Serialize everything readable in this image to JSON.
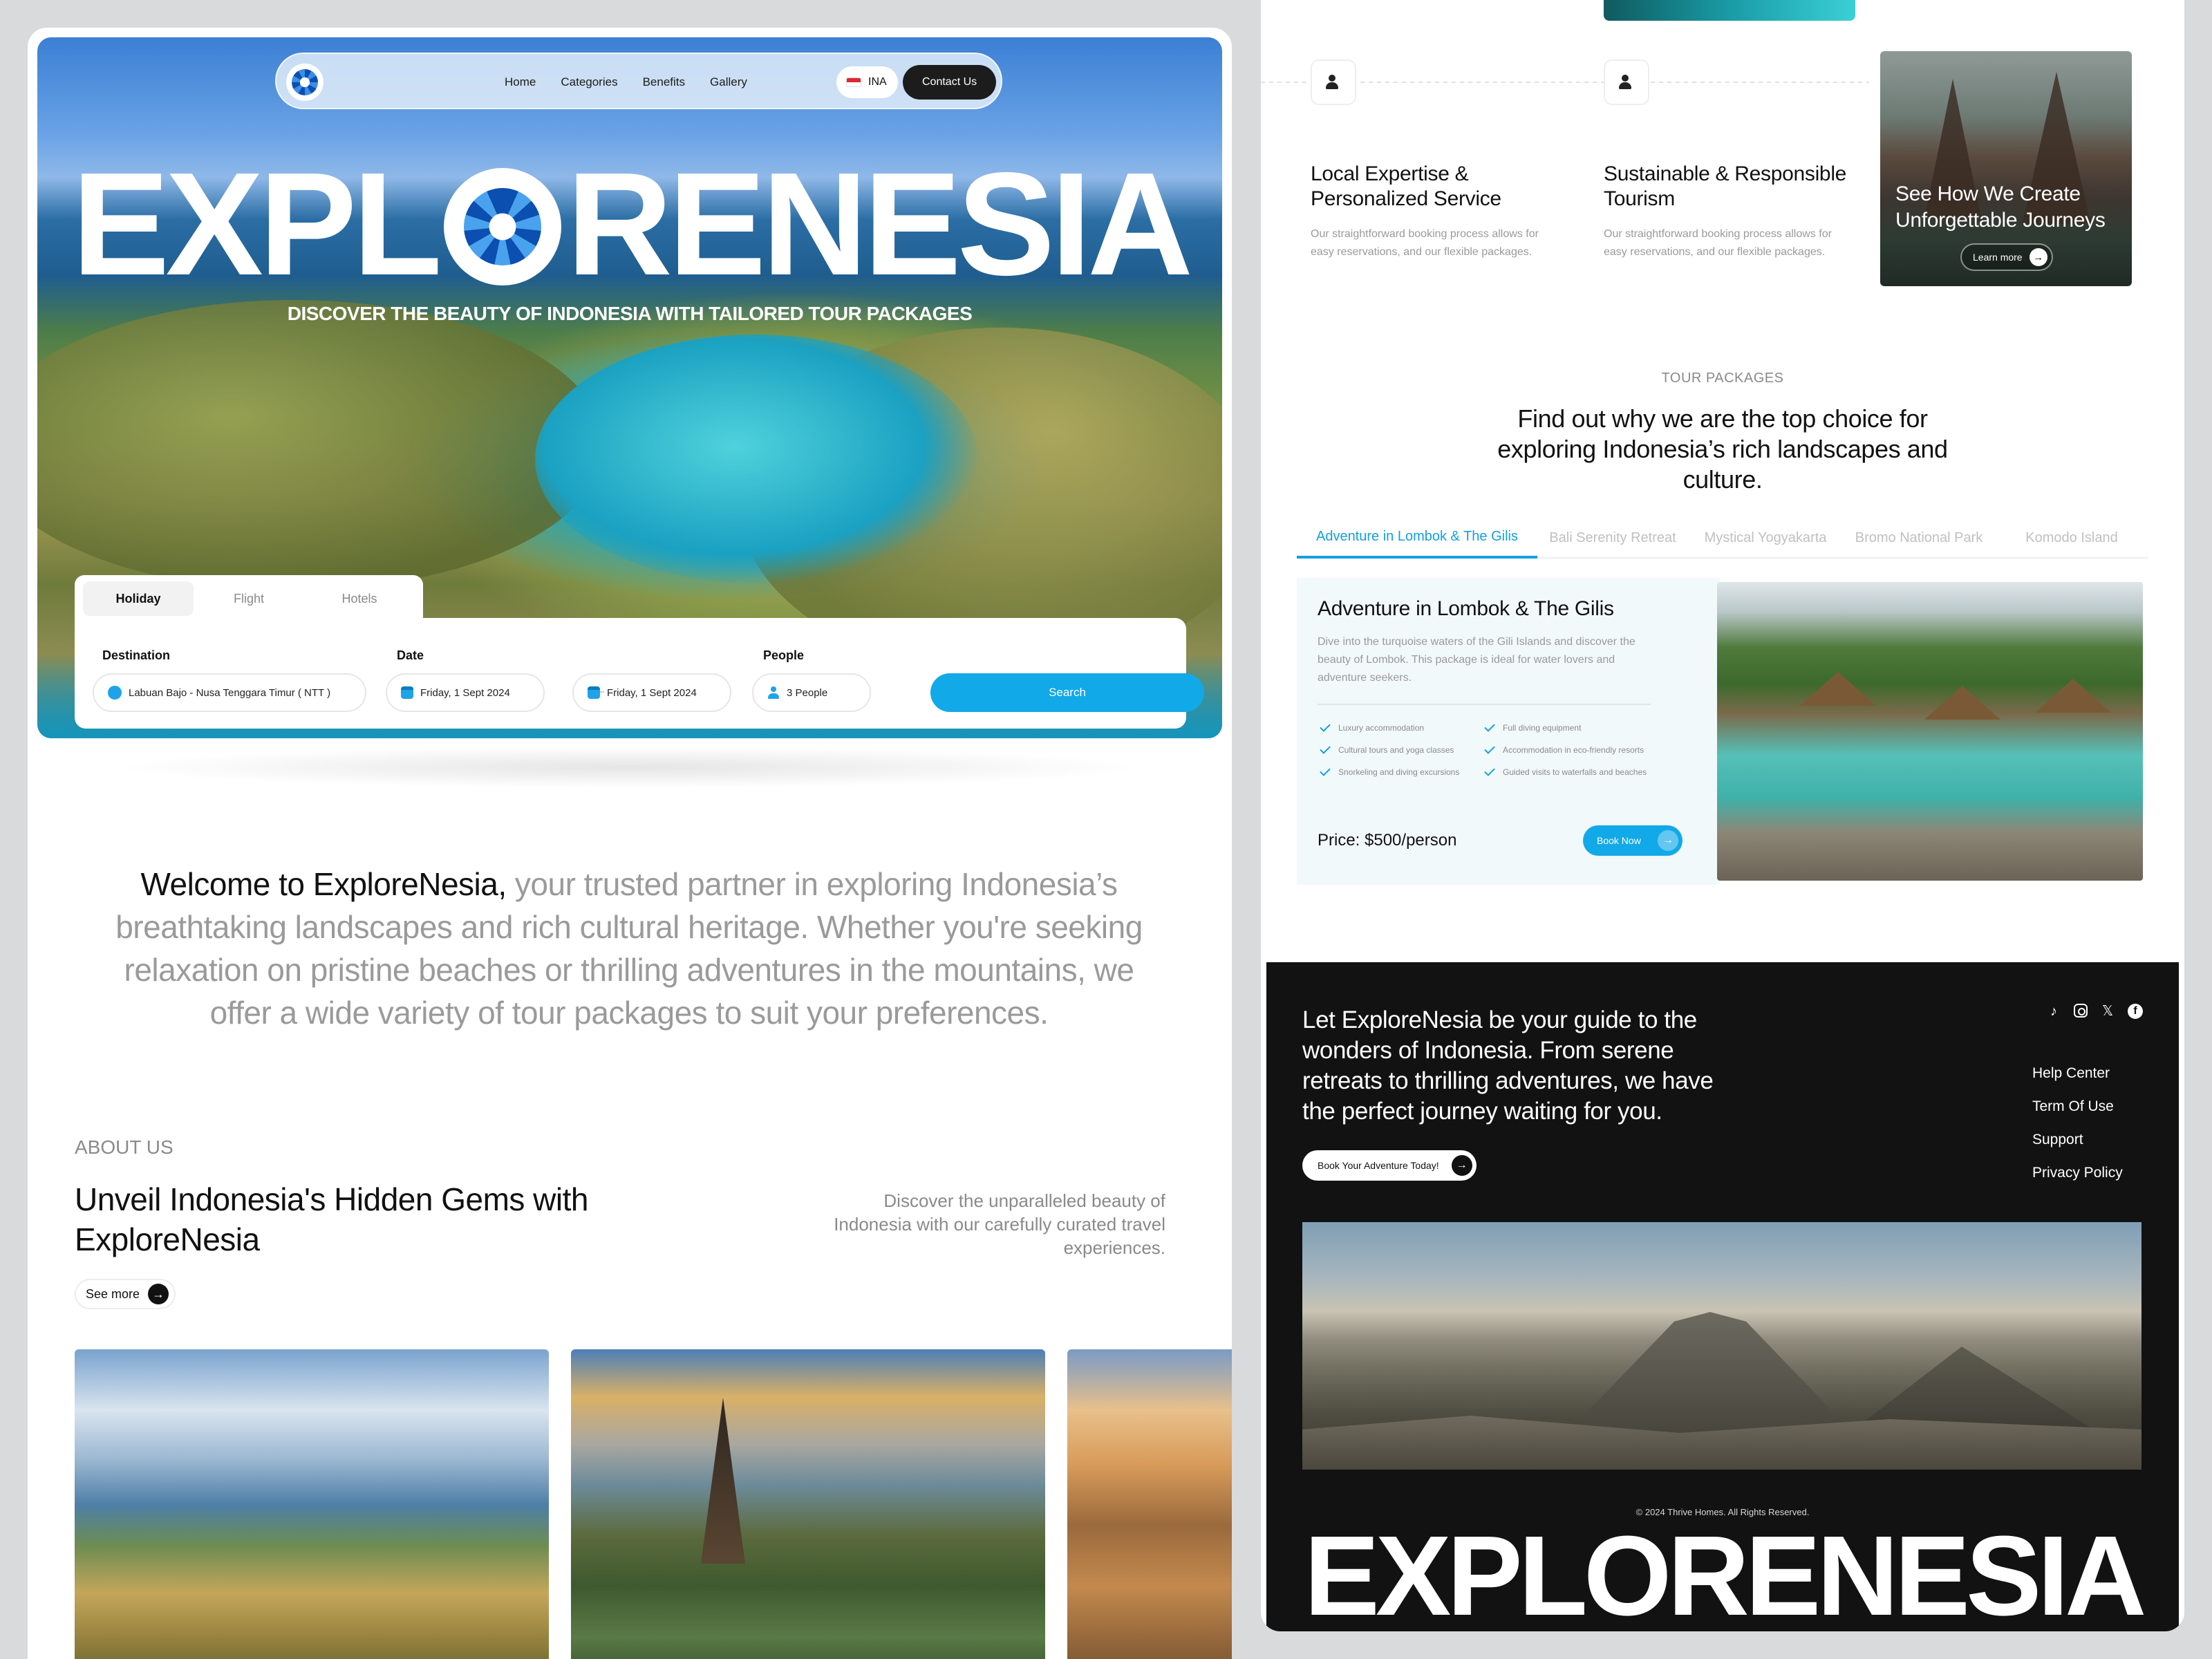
{
  "nav": {
    "links": [
      "Home",
      "Categories",
      "Benefits",
      "Gallery"
    ],
    "language": "INA",
    "contact_label": "Contact Us"
  },
  "hero": {
    "title_before": "EXPL",
    "title_after": "RENESIA",
    "subtitle": "DISCOVER THE BEAUTY OF INDONESIA WITH TAILORED TOUR PACKAGES"
  },
  "search": {
    "tabs": [
      "Holiday",
      "Flight",
      "Hotels"
    ],
    "active_tab": "Holiday",
    "destination_label": "Destination",
    "destination_value": "Labuan Bajo - Nusa Tenggara Timur ( NTT )",
    "date_label": "Date",
    "date_from": "Friday, 1 Sept  2024",
    "date_to": "Friday, 1 Sept 2024",
    "people_label": "People",
    "people_value": "3 People",
    "search_label": "Search"
  },
  "welcome": {
    "lead": "Welcome to ExploreNesia,",
    "rest": " your trusted partner in exploring Indonesia’s breathtaking landscapes and rich cultural heritage. Whether you're seeking relaxation on pristine beaches or thrilling adventures in the mountains, we offer a wide variety of tour packages to suit your preferences."
  },
  "about": {
    "label": "ABOUT US",
    "title": "Unveil Indonesia's Hidden Gems with ExploreNesia",
    "description": "Discover the unparalleled beauty of Indonesia with our carefully curated travel experiences.",
    "see_more": "See more"
  },
  "features": [
    {
      "title": "Local Expertise & Personalized Service",
      "description": "Our straightforward booking process allows for easy reservations, and our flexible packages."
    },
    {
      "title": "Sustainable & Responsible Tourism",
      "description": "Our straightforward booking process allows for easy reservations, and our flexible packages."
    }
  ],
  "promo": {
    "title": "See How We Create Unforgettable Journeys",
    "button": "Learn more"
  },
  "tour_packages": {
    "label": "TOUR PACKAGES",
    "title": "Find out why we are the top choice for exploring Indonesia’s rich landscapes and culture.",
    "tabs": [
      "Adventure in Lombok & The Gilis",
      "Bali Serenity Retreat",
      "Mystical Yogyakarta",
      "Bromo National Park",
      "Komodo Island"
    ],
    "active_tab": "Adventure in Lombok & The Gilis",
    "card": {
      "title": "Adventure in Lombok & The Gilis",
      "description": "Dive into the turquoise waters of the Gili Islands and discover the beauty of Lombok. This package is ideal for water lovers and adventure seekers.",
      "features_left": [
        "Luxury accommodation",
        "Cultural tours and yoga classes",
        "Snorkeling and diving excursions"
      ],
      "features_right": [
        "Full diving equipment",
        "Accommodation in eco-friendly resorts",
        "Guided visits to waterfalls and beaches"
      ],
      "price": "Price: $500/person",
      "book_label": "Book Now"
    }
  },
  "footer": {
    "text": "Let ExploreNesia be your guide to the wonders of Indonesia. From serene retreats to thrilling adventures, we have the perfect journey waiting for you.",
    "cta": "Book Your Adventure Today!",
    "socials": [
      "tiktok-icon",
      "instagram-icon",
      "x-icon",
      "facebook-icon"
    ],
    "links": [
      "Help Center",
      "Term Of Use",
      "Support",
      "Privacy Policy"
    ],
    "copyright": "© 2024 Thrive Homes. All Rights Reserved.",
    "brand": "EXPLORENESIA"
  },
  "colors": {
    "accent": "#12a9e8",
    "dark": "#121212",
    "logo_blue": "#0b4fb0"
  }
}
